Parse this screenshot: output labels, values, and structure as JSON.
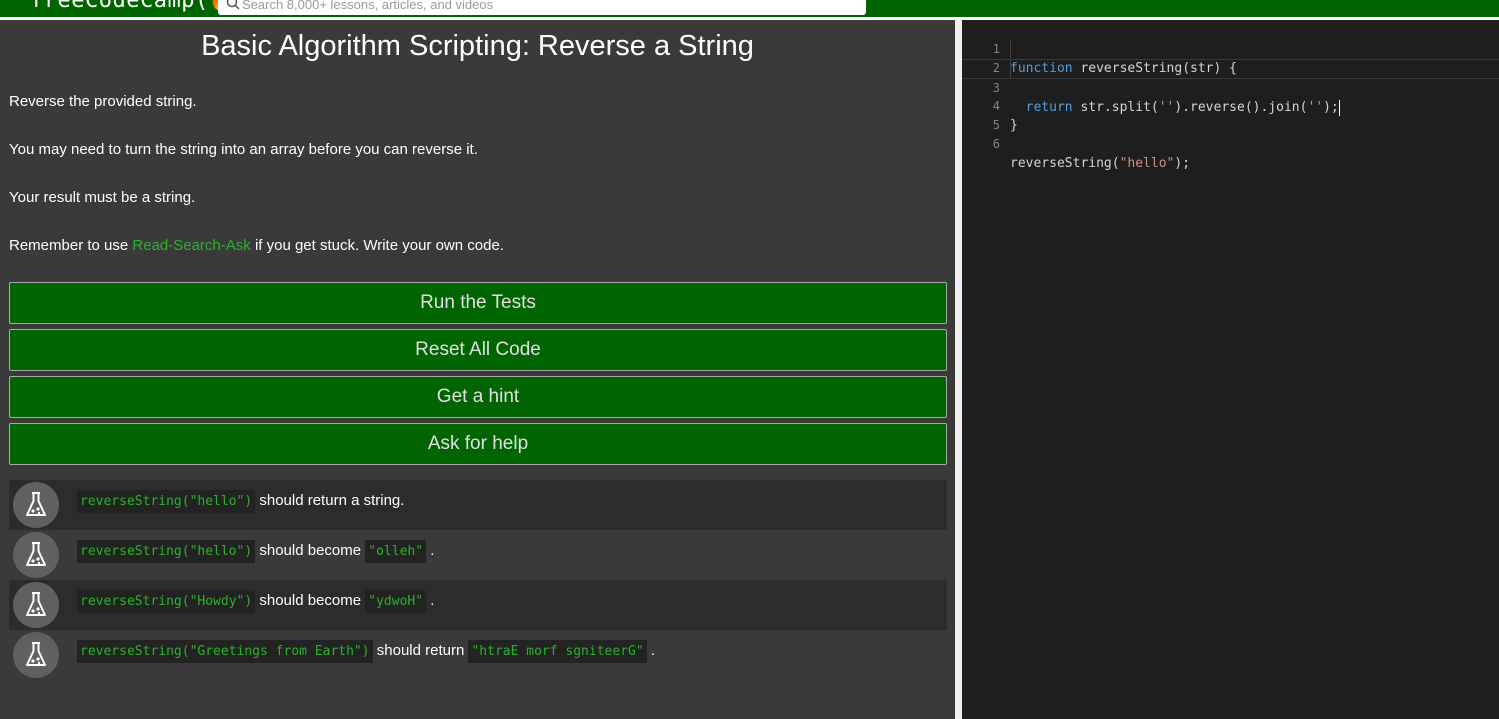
{
  "nav": {
    "logo": "freeCodeCamp(🔥)",
    "search_placeholder": "Search 8,000+ lessons, articles, and videos"
  },
  "challenge": {
    "title": "Basic Algorithm Scripting: Reverse a String",
    "paragraphs": {
      "p1": "Reverse the provided string.",
      "p2": "You may need to turn the string into an array before you can reverse it.",
      "p3": "Your result must be a string.",
      "p4_before": "Remember to use ",
      "p4_link": "Read-Search-Ask",
      "p4_after": " if you get stuck. Write your own code."
    },
    "buttons": {
      "run": "Run the Tests",
      "reset": "Reset All Code",
      "hint": "Get a hint",
      "help": "Ask for help"
    },
    "tests": [
      {
        "code": "reverseString(\"hello\")",
        "text": " should return a string.",
        "expected": "",
        "tail": ""
      },
      {
        "code": "reverseString(\"hello\")",
        "text": " should become ",
        "expected": "\"olleh\"",
        "tail": " ."
      },
      {
        "code": "reverseString(\"Howdy\")",
        "text": " should become ",
        "expected": "\"ydwoH\"",
        "tail": " ."
      },
      {
        "code": "reverseString(\"Greetings from Earth\")",
        "text": " should return ",
        "expected": "\"htraE morf sgniteerG\"",
        "tail": " ."
      }
    ]
  },
  "editor": {
    "line_numbers": [
      "1",
      "2",
      "3",
      "4",
      "5",
      "6"
    ],
    "line1_kw": "function",
    "line1_rest": " reverseString(str) {",
    "line3_kw": "return",
    "line3_a": " str.split(",
    "line3_s1": "''",
    "line3_b": ").reverse().join(",
    "line3_s2": "''",
    "line3_c": ");",
    "line4": "}",
    "line6_a": "reverseString(",
    "line6_s": "\"hello\"",
    "line6_b": ");"
  },
  "colors": {
    "nav_green": "#006400",
    "button_green": "#006400",
    "link_green": "#2bb22b",
    "panel_bg": "#3a3a3a",
    "editor_bg": "#1e1e1e",
    "keyword": "#569cd6",
    "string": "#ce9178"
  }
}
